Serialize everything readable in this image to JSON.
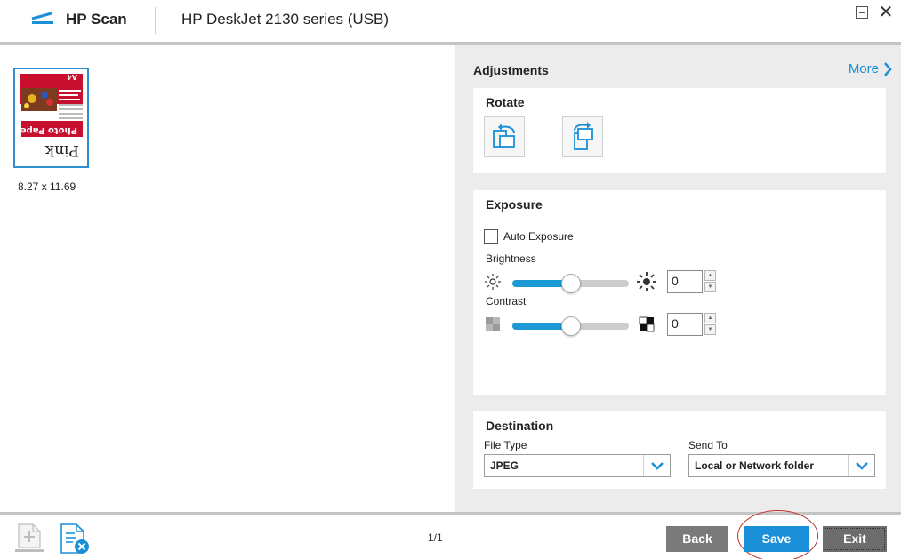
{
  "app": {
    "name": "HP Scan",
    "device": "HP DeskJet 2130 series (USB)"
  },
  "window": {
    "minimize_icon": "minimize-icon",
    "close_glyph": "✕"
  },
  "preview": {
    "thumbnail_texts": {
      "brand": "Pink",
      "product": "Photo Paper",
      "size_tag": "A4"
    },
    "page_size_label": "8.27  x  11.69"
  },
  "panel": {
    "title": "Adjustments",
    "more_label": "More",
    "rotate": {
      "title": "Rotate",
      "left_icon": "rotate-left-icon",
      "right_icon": "rotate-right-icon"
    },
    "exposure": {
      "title": "Exposure",
      "auto_label": "Auto Exposure",
      "auto_checked": false,
      "brightness": {
        "label": "Brightness",
        "value": "0",
        "level_percent": 50
      },
      "contrast": {
        "label": "Contrast",
        "value": "0",
        "level_percent": 50
      }
    },
    "destination": {
      "title": "Destination",
      "file_type_label": "File Type",
      "file_type_value": "JPEG",
      "send_to_label": "Send To",
      "send_to_value": "Local or Network folder"
    }
  },
  "footer": {
    "page_indicator": "1/1",
    "back_label": "Back",
    "save_label": "Save",
    "exit_label": "Exit"
  },
  "colors": {
    "accent": "#1b8fd8",
    "panel_bg": "#ececec",
    "annotation": "#c03030"
  }
}
